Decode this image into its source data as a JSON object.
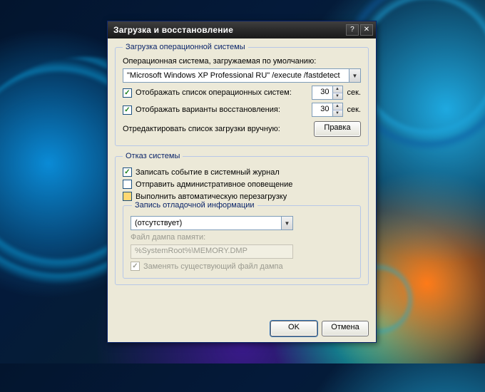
{
  "window": {
    "title": "Загрузка и восстановление",
    "help_glyph": "?",
    "close_glyph": "✕"
  },
  "startup": {
    "legend": "Загрузка операционной системы",
    "default_os_label": "Операционная система, загружаемая по умолчанию:",
    "default_os_value": "\"Microsoft Windows XP Professional RU\" /execute /fastdetect",
    "show_os_list_label": "Отображать список операционных систем:",
    "show_os_list_checked": "✓",
    "show_os_list_seconds": "30",
    "show_recovery_label": "Отображать варианты восстановления:",
    "show_recovery_checked": "✓",
    "show_recovery_seconds": "30",
    "seconds_suffix": "сек.",
    "edit_manual_label": "Отредактировать список загрузки вручную:",
    "edit_button": "Правка"
  },
  "failure": {
    "legend": "Отказ системы",
    "write_event_label": "Записать событие в системный журнал",
    "write_event_checked": "✓",
    "send_admin_alert_label": "Отправить административное оповещение",
    "send_admin_alert_checked": "",
    "auto_restart_label": "Выполнить автоматическую перезагрузку",
    "auto_restart_checked": "",
    "debug": {
      "legend": "Запись отладочной информации",
      "type_value": "(отсутствует)",
      "dump_file_label": "Файл дампа памяти:",
      "dump_file_value": "%SystemRoot%\\MEMORY.DMP",
      "overwrite_label": "Заменять существующий файл дампа",
      "overwrite_checked": "✓"
    }
  },
  "buttons": {
    "ok": "OK",
    "cancel": "Отмена"
  }
}
